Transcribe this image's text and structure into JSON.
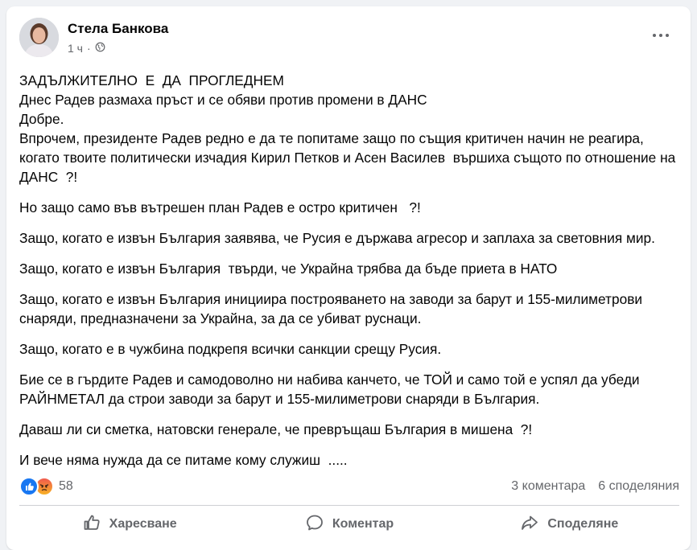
{
  "post": {
    "author": "Стела Банкова",
    "time": "1 ч",
    "time_separator": "·",
    "audience_icon": "globe-icon",
    "paragraphs_block": [
      "ЗАДЪЛЖИТЕЛНО  Е  ДА  ПРОГЛЕДНЕМ",
      "Днес Радев размаха пръст и се обяви против промени в ДАНС",
      "Добре.",
      "Впрочем, президенте Радев редно е да те попитаме защо по същия критичен начин не реагира,  когато твоите политически изчадия Кирил Петков и Асен Василев  вършиха същото по отношение на ДАНС  ?!"
    ],
    "paragraphs": [
      "Но защо само във вътрешен план Радев е остро критичен   ?!",
      "Защо, когато е извън България заявява, че Русия е държава агресор и заплаха за световния мир.",
      "Защо, когато е извън България  твърди, че Украйна трябва да бъде приета в НАТО",
      "Защо, когато е извън България инициира построяването на заводи за барут и 155-милиметрови снаряди, предназначени за Украйна, за да се убиват руснаци.",
      "Защо, когато е в чужбина подкрепя всички санкции срещу Русия.",
      "Бие се в гърдите Радев и самодоволно ни набива канчето, че ТОЙ и само той е успял да убеди РАЙНМЕТАЛ да строи заводи за барут и 155-милиметрови снаряди в България.",
      "Даваш ли си сметка, натовски генерале, че превръщаш България в мишена  ?!",
      "И вече няма нужда да се питаме кому служиш  ....."
    ]
  },
  "stats": {
    "reaction_icons": [
      "like-reaction-icon",
      "angry-reaction-icon"
    ],
    "reaction_count": "58",
    "comments": "3 коментара",
    "shares": "6 споделяния"
  },
  "actions": {
    "like": "Харесване",
    "comment": "Коментар",
    "share": "Споделяне"
  },
  "colors": {
    "accent": "#1877f2",
    "text": "#050505",
    "muted": "#65676b",
    "background": "#f0f2f5"
  }
}
